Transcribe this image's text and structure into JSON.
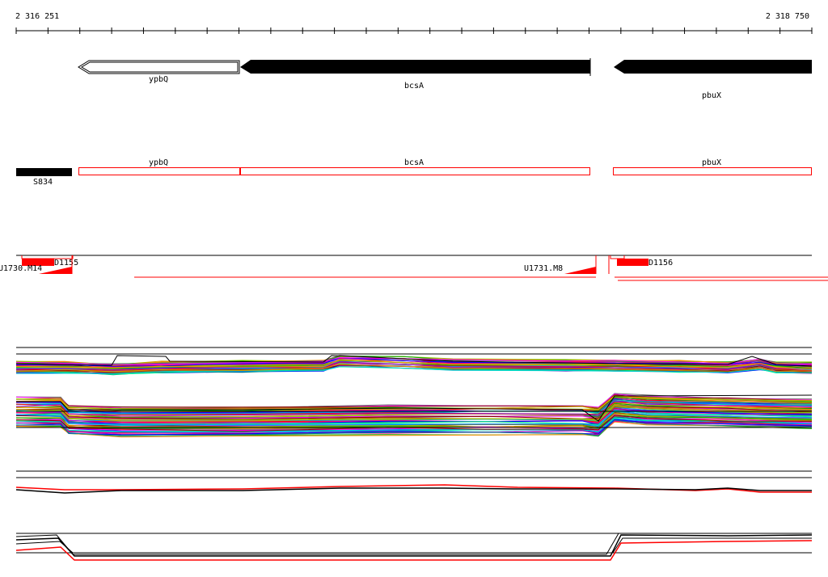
{
  "ruler": {
    "start_label": "2 316 251",
    "end_label": "2 318 750"
  },
  "genes": [
    {
      "name": "ypbQ",
      "strand": "-",
      "filled": false
    },
    {
      "name": "bcsA",
      "strand": "-",
      "filled": true
    },
    {
      "name": "pbuX",
      "strand": "-",
      "filled": true
    }
  ],
  "annotations": {
    "other_feature": "S834",
    "cds": [
      "ypbQ",
      "bcsA",
      "pbuX"
    ]
  },
  "transcription_units": {
    "d_labels": [
      "D1155",
      "D1156"
    ],
    "u_labels": [
      "U1730.M14",
      "U1731.M8"
    ]
  },
  "colors": {
    "gene_fill": "#000000",
    "cds_outline": "#ff0000",
    "segment": "#ff0000",
    "axis": "#000000"
  },
  "expression_tracks": [
    {
      "name": "condition profiles track 1",
      "style": "multicolor"
    },
    {
      "name": "condition profiles track 2",
      "style": "multicolor"
    },
    {
      "name": "strand summary track 1",
      "style": "black-red"
    },
    {
      "name": "strand summary track 2",
      "style": "black-red"
    }
  ]
}
